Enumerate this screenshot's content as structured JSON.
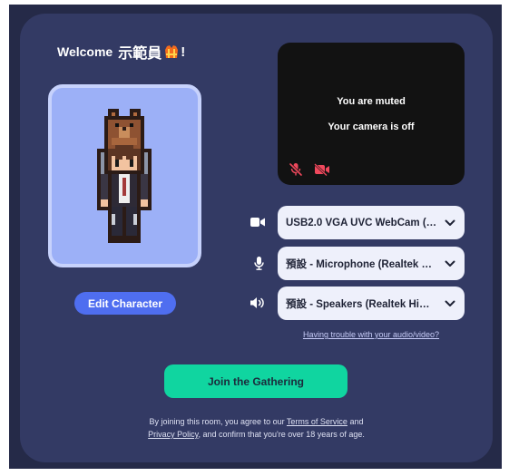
{
  "header": {
    "greeting": "Welcome",
    "user_name": "示範員",
    "emoji_icon": "safety-vest-emoji-icon",
    "exclamation": "!"
  },
  "character": {
    "edit_button_label": "Edit Character"
  },
  "preview": {
    "muted_text": "You are muted",
    "camera_off_text": "Your camera is off",
    "mic_status_icon": "mic-off-icon",
    "camera_status_icon": "camera-off-icon"
  },
  "devices": [
    {
      "icon": "camera-icon",
      "selected": "USB2.0 VGA UVC WebCam (…"
    },
    {
      "icon": "microphone-icon",
      "selected": "預設 - Microphone (Realtek …"
    },
    {
      "icon": "speaker-icon",
      "selected": "預設 - Speakers (Realtek Hi…"
    }
  ],
  "help_link": "Having trouble with your audio/video?",
  "join_button_label": "Join the Gathering",
  "legal": {
    "prefix": "By joining this room, you agree to our ",
    "terms_link": "Terms of Service",
    "line1_end": " and",
    "privacy_link": "Privacy Policy",
    "suffix": ", and confirm that you're over 18 years of age."
  },
  "colors": {
    "page_background": "#ffffff",
    "frame": "#252a48",
    "card": "#333a64",
    "avatar_fill": "#9cb0f7",
    "avatar_border": "#c7d2fc",
    "edit_button": "#4f6ef0",
    "preview_background": "#121212",
    "status_icon_red": "#f0485c",
    "select_background": "#eef0fb",
    "link": "#c7ccf8",
    "join_button": "#10d5a0"
  }
}
